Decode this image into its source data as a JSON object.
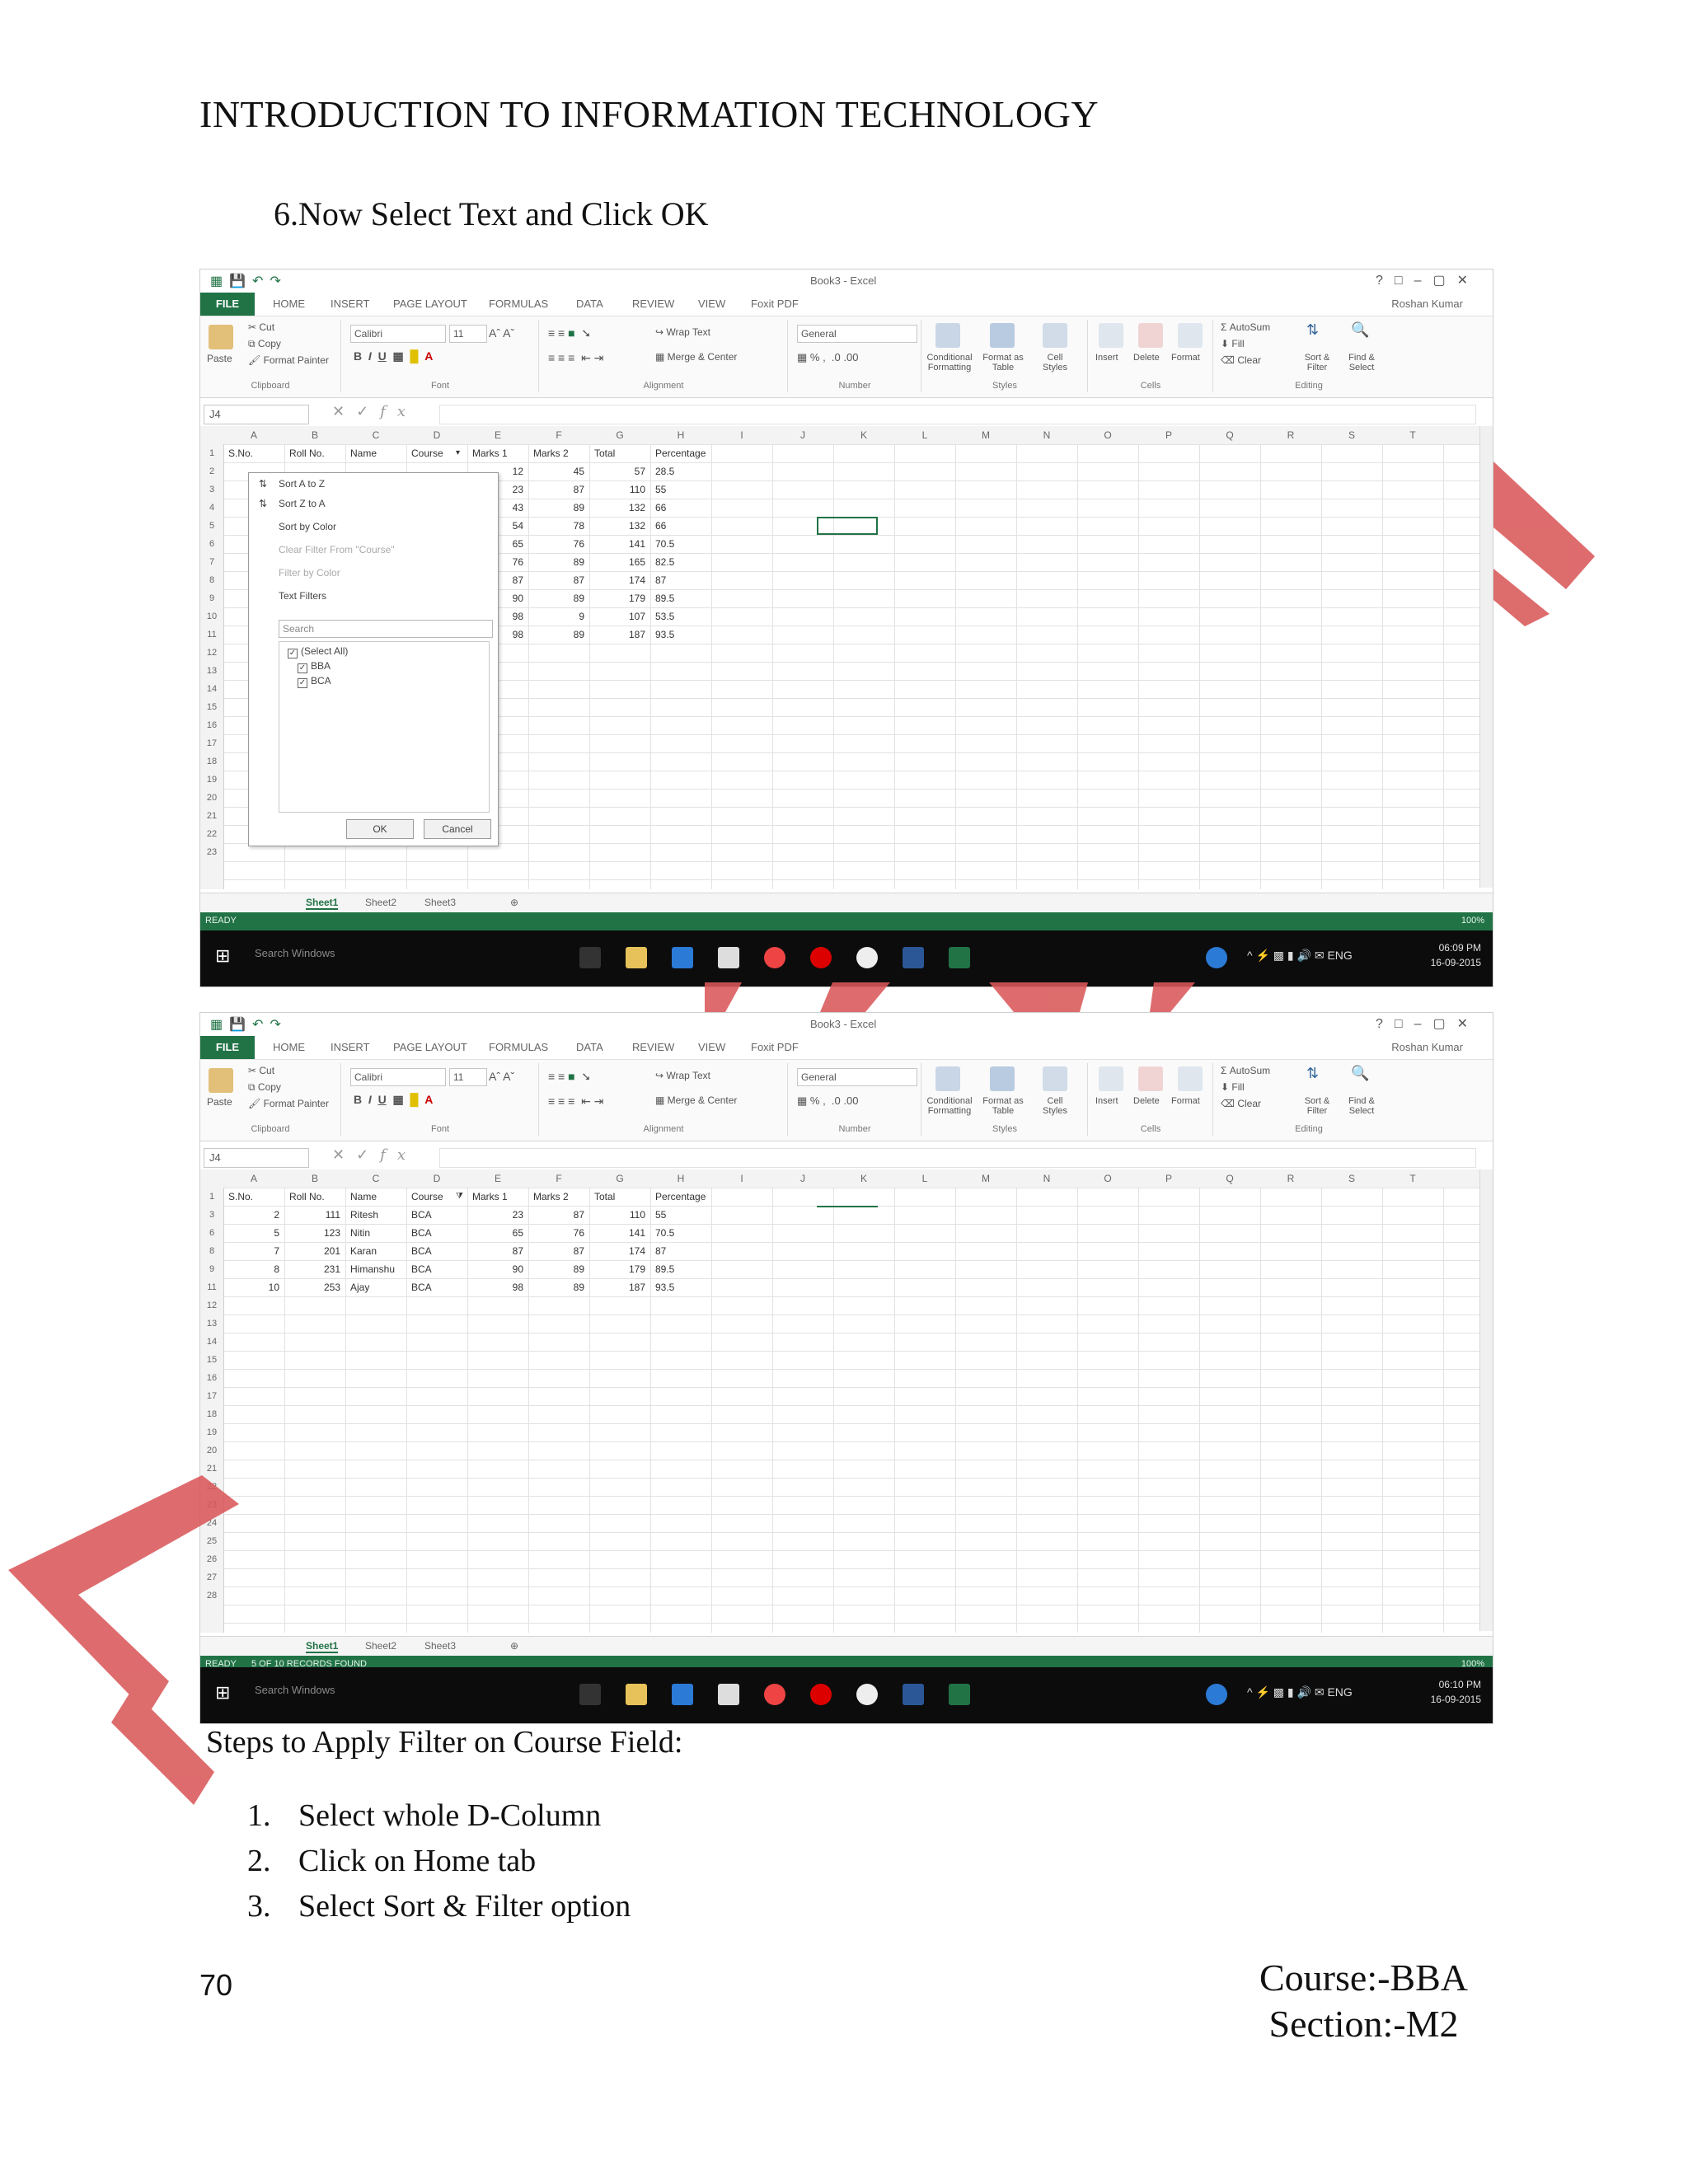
{
  "header": {
    "title": "INTRODUCTION TO INFORMATION TECHNOLOGY"
  },
  "step6": {
    "number": "6.",
    "text": "Now Select Text and Click OK"
  },
  "excel": {
    "window_title": "Book3 - Excel",
    "user": "Roshan Kumar",
    "tabs": [
      "FILE",
      "HOME",
      "INSERT",
      "PAGE LAYOUT",
      "FORMULAS",
      "DATA",
      "REVIEW",
      "VIEW",
      "Foxit PDF"
    ],
    "ribbon": {
      "paste": "Paste",
      "cut": "Cut",
      "copy": "Copy",
      "format_painter": "Format Painter",
      "clipboard": "Clipboard",
      "font_name": "Calibri",
      "font_size": "11",
      "font": "Font",
      "wrap_text": "Wrap Text",
      "merge_center": "Merge & Center",
      "alignment": "Alignment",
      "number_format": "General",
      "number": "Number",
      "conditional": "Conditional Formatting",
      "format_table": "Format as Table",
      "cell_styles": "Cell Styles",
      "styles": "Styles",
      "insert": "Insert",
      "delete": "Delete",
      "format": "Format",
      "cells": "Cells",
      "autosum": "AutoSum",
      "fill": "Fill",
      "clear": "Clear",
      "sort_filter": "Sort & Filter",
      "find_select": "Find & Select",
      "editing": "Editing"
    },
    "name_box": "J4",
    "fx": "fx",
    "columns": [
      "A",
      "B",
      "C",
      "D",
      "E",
      "F",
      "G",
      "H",
      "I",
      "J",
      "K",
      "L",
      "M",
      "N",
      "O",
      "P",
      "Q",
      "R",
      "S",
      "T"
    ],
    "headers": [
      "S.No.",
      "Roll No.",
      "Name",
      "Course",
      "Marks 1",
      "Marks 2",
      "Total",
      "Percentage"
    ],
    "sheet_tabs": [
      "Sheet1",
      "Sheet2",
      "Sheet3"
    ],
    "zoom": "100%",
    "taskbar": {
      "search": "Search Windows",
      "lang": "ENG"
    }
  },
  "shot1": {
    "rows_visible": [
      "1",
      "2",
      "3",
      "4",
      "5",
      "6",
      "7",
      "8",
      "9",
      "10",
      "11",
      "12",
      "13",
      "14",
      "15",
      "16",
      "17",
      "18",
      "19",
      "20",
      "21",
      "22",
      "23"
    ],
    "data": [
      {
        "m1": "12",
        "m2": "45",
        "total": "57",
        "pct": "28.5"
      },
      {
        "m1": "23",
        "m2": "87",
        "total": "110",
        "pct": "55"
      },
      {
        "m1": "43",
        "m2": "89",
        "total": "132",
        "pct": "66"
      },
      {
        "m1": "54",
        "m2": "78",
        "total": "132",
        "pct": "66"
      },
      {
        "m1": "65",
        "m2": "76",
        "total": "141",
        "pct": "70.5"
      },
      {
        "m1": "76",
        "m2": "89",
        "total": "165",
        "pct": "82.5"
      },
      {
        "m1": "87",
        "m2": "87",
        "total": "174",
        "pct": "87"
      },
      {
        "m1": "90",
        "m2": "89",
        "total": "179",
        "pct": "89.5"
      },
      {
        "m1": "98",
        "m2": "9",
        "total": "107",
        "pct": "53.5"
      },
      {
        "m1": "98",
        "m2": "89",
        "total": "187",
        "pct": "93.5"
      }
    ],
    "filter_menu": {
      "sort_az": "Sort A to Z",
      "sort_za": "Sort Z to A",
      "sort_color": "Sort by Color",
      "clear_filter": "Clear Filter From \"Course\"",
      "filter_color": "Filter by Color",
      "text_filters": "Text Filters",
      "search": "Search",
      "items": [
        "(Select All)",
        "BBA",
        "BCA"
      ],
      "ok": "OK",
      "cancel": "Cancel"
    },
    "status": "READY",
    "time": "06:09 PM",
    "date": "16-09-2015"
  },
  "shot2": {
    "rows_visible": [
      "1",
      "3",
      "6",
      "8",
      "9",
      "11",
      "12",
      "13",
      "14",
      "15",
      "16",
      "17",
      "18",
      "19",
      "20",
      "21",
      "22",
      "23",
      "24",
      "25",
      "26",
      "27",
      "28"
    ],
    "data": [
      {
        "sno": "2",
        "roll": "111",
        "name": "Ritesh",
        "course": "BCA",
        "m1": "23",
        "m2": "87",
        "total": "110",
        "pct": "55"
      },
      {
        "sno": "5",
        "roll": "123",
        "name": "Nitin",
        "course": "BCA",
        "m1": "65",
        "m2": "76",
        "total": "141",
        "pct": "70.5"
      },
      {
        "sno": "7",
        "roll": "201",
        "name": "Karan",
        "course": "BCA",
        "m1": "87",
        "m2": "87",
        "total": "174",
        "pct": "87"
      },
      {
        "sno": "8",
        "roll": "231",
        "name": "Himanshu",
        "course": "BCA",
        "m1": "90",
        "m2": "89",
        "total": "179",
        "pct": "89.5"
      },
      {
        "sno": "10",
        "roll": "253",
        "name": "Ajay",
        "course": "BCA",
        "m1": "98",
        "m2": "89",
        "total": "187",
        "pct": "93.5"
      }
    ],
    "status": "READY",
    "records": "5 OF 10 RECORDS FOUND",
    "time": "06:10 PM",
    "date": "16-09-2015"
  },
  "steps": {
    "heading": "Steps to Apply Filter  on Course Field:",
    "items": [
      {
        "n": "1.",
        "text": "Select whole D-Column"
      },
      {
        "n": "2.",
        "text": "Click on Home tab"
      },
      {
        "n": "3.",
        "text": "Select Sort & Filter option"
      }
    ]
  },
  "footer": {
    "page_number": "70",
    "course": "Course:-BBA",
    "section": "Section:-M2"
  },
  "colors": {
    "excel_green": "#217346",
    "watermark": "#d9585a"
  }
}
